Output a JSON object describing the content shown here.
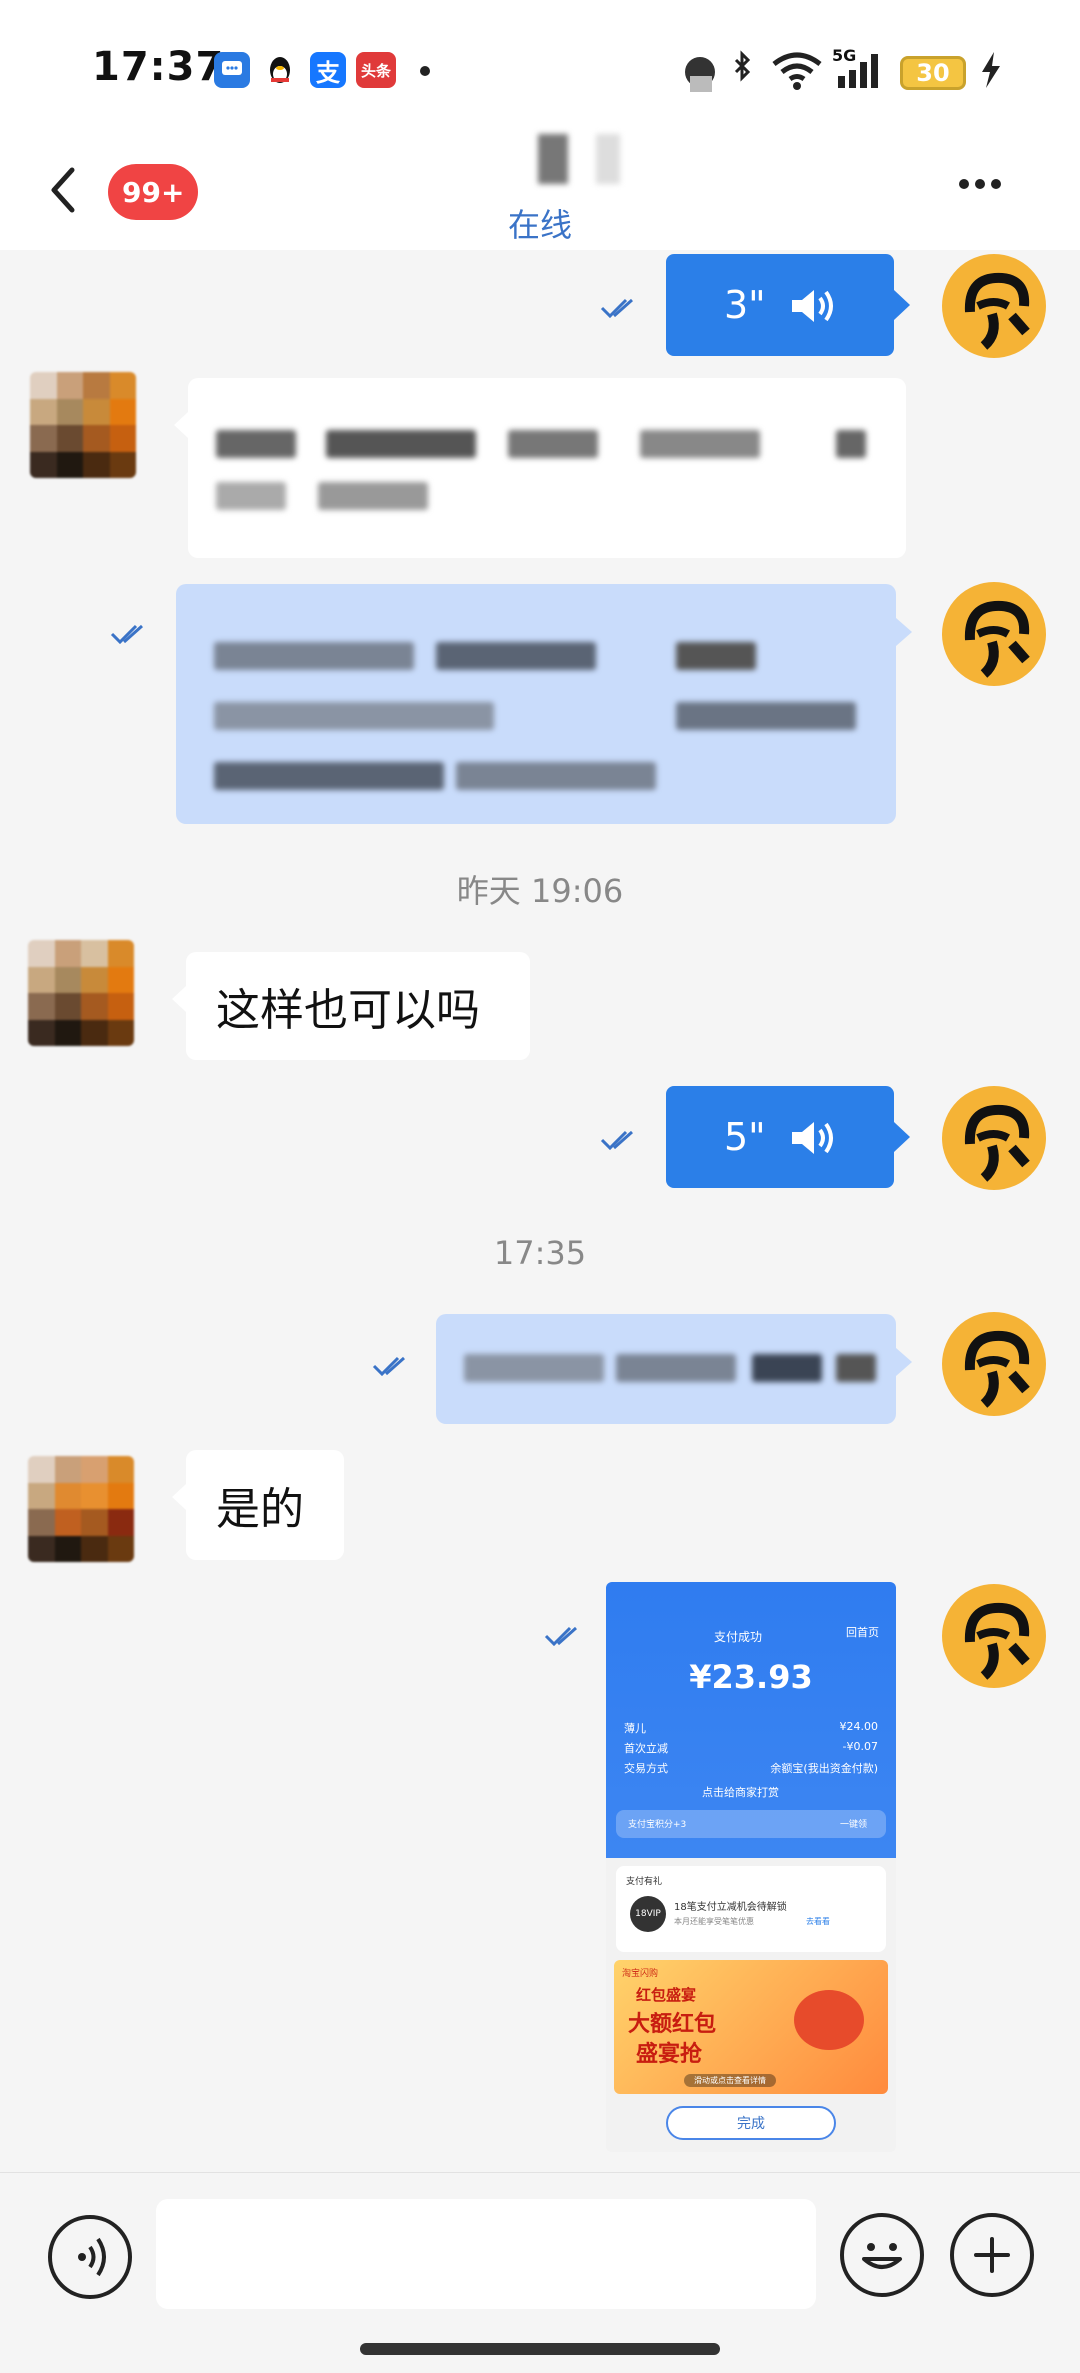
{
  "status_bar": {
    "time": "17:37",
    "notif_alipay": "支",
    "notif_toutiao": "头条",
    "network": "5G",
    "battery": "30"
  },
  "header": {
    "unread_badge": "99+",
    "status": "在线"
  },
  "messages": {
    "voice1_duration": "3\"",
    "timestamp1": "昨天 19:06",
    "text1": "这样也可以吗",
    "voice2_duration": "5\"",
    "timestamp2": "17:35",
    "text2": "是的",
    "screenshot": {
      "status": "支付成功",
      "top_right": "回首页",
      "amount": "¥23.93",
      "rows": [
        {
          "label": "薄儿",
          "value": "¥24.00"
        },
        {
          "label": "首次立减",
          "value": "-¥0.07"
        },
        {
          "label": "交易方式",
          "value": "余额宝(我出资金付款)"
        }
      ],
      "merchant_link": "点击给商家打赏",
      "points": "支付宝积分+3",
      "points_action": "一键领",
      "gift_title": "支付有礼",
      "vip_tag": "18VIP",
      "vip_text": "18笔支付立减机会待解锁",
      "vip_sub": "本月还能享受笔笔优惠",
      "vip_action": "去看看",
      "ad_brand": "淘宝闪购",
      "ad_title1": "红包盛宴",
      "ad_title2": "大额红包",
      "ad_title3": "盛宴抢",
      "ad_footer": "滑动或点击查看详情",
      "done": "完成"
    }
  }
}
